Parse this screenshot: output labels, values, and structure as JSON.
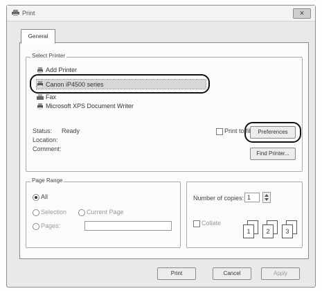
{
  "window": {
    "title": "Print",
    "close_glyph": "✕"
  },
  "tabs": [
    {
      "label": "General"
    }
  ],
  "select_printer": {
    "legend": "Select Printer",
    "printers": [
      {
        "name": "Add Printer",
        "icon": "add-printer-icon"
      },
      {
        "name": "Canon iP4500 series",
        "icon": "printer-icon",
        "selected": true
      },
      {
        "name": "Fax",
        "icon": "fax-icon"
      },
      {
        "name": "Microsoft XPS Document Writer",
        "icon": "printer-icon"
      }
    ],
    "status_label": "Status:",
    "status_value": "Ready",
    "location_label": "Location:",
    "comment_label": "Comment:",
    "print_to_file_label": "Print to file",
    "print_to_file_checked": false,
    "preferences_button": "Preferences",
    "find_printer_button": "Find Printer..."
  },
  "page_range": {
    "legend": "Page Range",
    "options": [
      {
        "label": "All",
        "selected": true
      },
      {
        "label": "Selection",
        "selected": false
      },
      {
        "label": "Current Page",
        "selected": false
      },
      {
        "label": "Pages:",
        "selected": false
      }
    ],
    "pages_value": ""
  },
  "copies": {
    "label": "Number of copies:",
    "value": "1",
    "collate_label": "Collate",
    "collate_checked": false,
    "page_sets": [
      "1",
      "1",
      "2",
      "2",
      "3",
      "3"
    ]
  },
  "buttons": {
    "print": "Print",
    "cancel": "Cancel",
    "apply": "Apply"
  },
  "colors": {
    "highlight_outline": "#111111",
    "selected_row": "#d7d7d7"
  }
}
